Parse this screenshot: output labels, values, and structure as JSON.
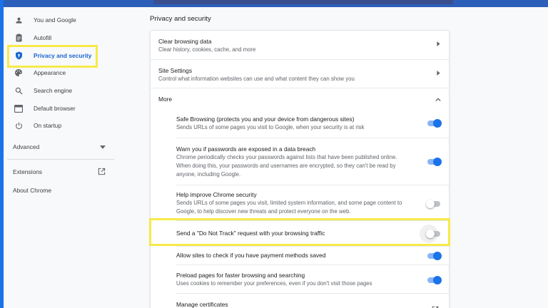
{
  "sidebar": {
    "items": [
      {
        "label": "You and Google",
        "icon": "person-icon"
      },
      {
        "label": "Autofill",
        "icon": "clipboard-icon"
      },
      {
        "label": "Privacy and security",
        "icon": "shield-icon",
        "active": true
      },
      {
        "label": "Appearance",
        "icon": "palette-icon"
      },
      {
        "label": "Search engine",
        "icon": "search-icon"
      },
      {
        "label": "Default browser",
        "icon": "browser-icon"
      },
      {
        "label": "On startup",
        "icon": "power-icon"
      }
    ],
    "advanced_label": "Advanced",
    "extensions_label": "Extensions",
    "about_label": "About Chrome"
  },
  "main": {
    "section_title": "Privacy and security",
    "clear_browsing": {
      "title": "Clear browsing data",
      "subtitle": "Clear history, cookies, cache, and more"
    },
    "site_settings": {
      "title": "Site Settings",
      "subtitle": "Control what information websites can use and what content they can show you"
    },
    "more_label": "More",
    "safe_browsing": {
      "title": "Safe Browsing (protects you and your device from dangerous sites)",
      "subtitle": "Sends URLs of some pages you visit to Google, when your security is at risk",
      "enabled": true
    },
    "password_warn": {
      "title": "Warn you if passwords are exposed in a data breach",
      "line1": "Chrome periodically checks your passwords against lists that have been published online.",
      "line2": "When doing this, your passwords and usernames are encrypted, so they can't be read by",
      "line3": "anyone, including Google.",
      "enabled": true
    },
    "improve_security": {
      "title": "Help improve Chrome security",
      "line1": "Sends URLs of some pages you visit, limited system information, and some page content to",
      "line2": "Google, to help discover new threats and protect everyone on the web.",
      "enabled": false
    },
    "do_not_track": {
      "title": "Send a \"Do Not Track\" request with your browsing traffic",
      "enabled": false
    },
    "payment_methods": {
      "title": "Allow sites to check if you have payment methods saved",
      "enabled": true
    },
    "preload": {
      "title": "Preload pages for faster browsing and searching",
      "subtitle": "Uses cookies to remember your preferences, even if you don't visit those pages",
      "enabled": true
    },
    "certificates": {
      "title": "Manage certificates"
    }
  },
  "colors": {
    "accent": "#1a73e8",
    "highlight": "#f7ea48"
  }
}
